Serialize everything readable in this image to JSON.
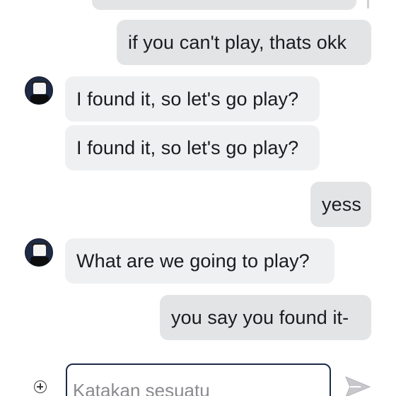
{
  "messages": [
    {
      "from": "me",
      "text": ""
    },
    {
      "from": "me",
      "text": "if you can't play, thats okk"
    },
    {
      "from": "friend",
      "text": "I found it, so let's go play?"
    },
    {
      "from": "friend",
      "text": "I found it, so let's go play?"
    },
    {
      "from": "me",
      "text": "yess"
    },
    {
      "from": "friend",
      "text": "What are we going to play?"
    },
    {
      "from": "me",
      "text": "you say you found it-"
    }
  ],
  "composer": {
    "placeholder": "Katakan sesuatu",
    "value": "",
    "plus_icon": "plus-circle-icon",
    "send_icon": "send-icon"
  },
  "colors": {
    "bubble_incoming": "#eff0f2",
    "bubble_outgoing": "#e3e4e6",
    "input_border": "#1c2a4a",
    "send_icon": "#c8c8cc"
  }
}
